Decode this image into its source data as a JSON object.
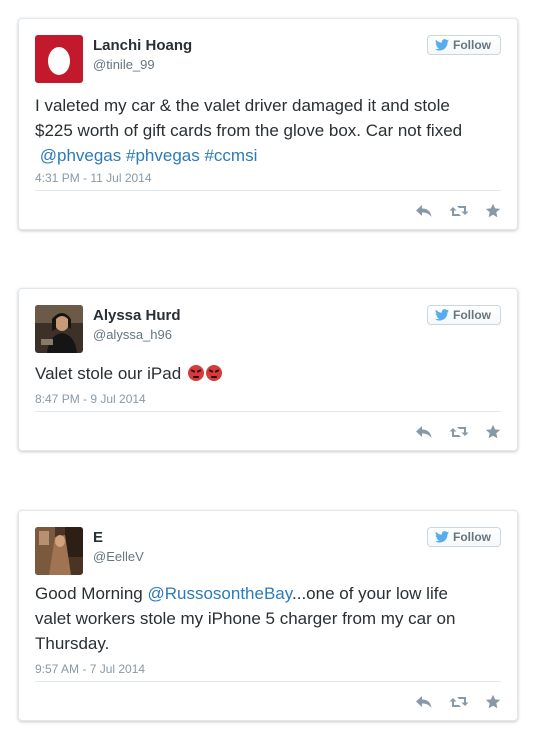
{
  "colors": {
    "link": "#2b7bb9",
    "twitter_blue": "#55acee",
    "action_icon": "#8899a6"
  },
  "follow_icon": "twitter-bird-icon",
  "follow_label": "Follow",
  "action_icons": [
    "reply-icon",
    "retweet-icon",
    "favorite-icon"
  ],
  "tweets": [
    {
      "name": "Lanchi Hoang",
      "handle": "@tinile_99",
      "avatar": "egg-avatar",
      "text_line1": "I valeted my car & the valet driver damaged it and stole",
      "text_line2": "$225 worth of gift cards from the glove box. Car not fixed",
      "links": [
        "@phvegas",
        "#phvegas",
        "#ccmsi"
      ],
      "date": "4:31 PM - 11 Jul 2014"
    },
    {
      "name": "Alyssa Hurd",
      "handle": "@alyssa_h96",
      "avatar": "photo-avatar",
      "text": "Valet stole our iPad",
      "emoji": "angry-face-icon",
      "date": "8:47 PM - 9 Jul 2014"
    },
    {
      "name": "E",
      "handle": "@EelleV",
      "avatar": "photo-avatar",
      "text_prefix": "Good Morning",
      "mention": "@RussosontheBay",
      "text_suffix": "...one of your low life",
      "text_line2": "valet workers stole my iPhone 5 charger from my car on",
      "text_line3": "Thursday.",
      "date": "9:57 AM - 7 Jul 2014"
    }
  ]
}
